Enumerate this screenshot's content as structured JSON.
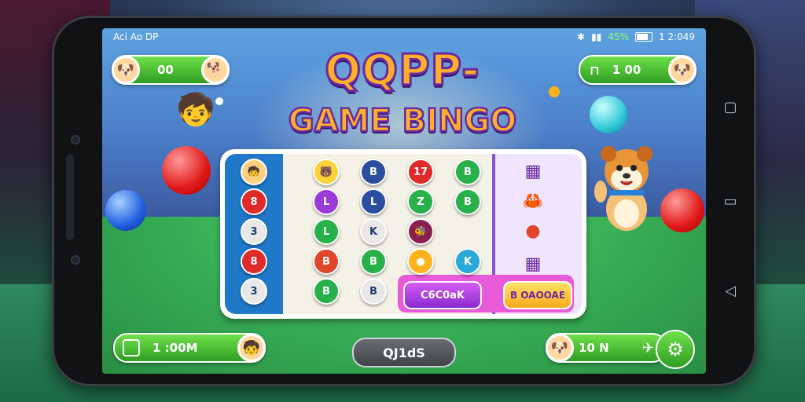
{
  "status_bar": {
    "left_text": "Aci Ao DP",
    "battery": "45%",
    "time": "1 2:049"
  },
  "title": {
    "line1": "QQPP-",
    "line2": "GAME BINGO"
  },
  "top_left_pill": {
    "value": "00",
    "icon": "dog-avatar-icon",
    "avatar": "dog-avatar-icon"
  },
  "top_right_pill": {
    "value": "1 00",
    "icon": "bottle-icon",
    "avatar": "dog-avatar-icon"
  },
  "board": {
    "left_column": [
      {
        "label": "",
        "color": "#ffd080",
        "icon": "kid-avatar-icon"
      },
      {
        "label": "8",
        "color": "#e02a2a"
      },
      {
        "label": "3",
        "color": "#e8e8e8"
      },
      {
        "label": "8",
        "color": "#e02a2a"
      },
      {
        "label": "3",
        "color": "#e8e8e8"
      }
    ],
    "grid": [
      {
        "label": "",
        "color": "#ffd23a",
        "icon": "bear-face-icon"
      },
      {
        "label": "B",
        "color": "#2a4fa0"
      },
      {
        "label": "17",
        "color": "#e02a2a"
      },
      {
        "label": "B",
        "color": "#28b04a"
      },
      {
        "label": "L",
        "color": "#9a3ad8"
      },
      {
        "label": "L",
        "color": "#2a4fa0"
      },
      {
        "label": "Z",
        "color": "#28b04a"
      },
      {
        "label": "B",
        "color": "#28b04a"
      },
      {
        "label": "L",
        "color": "#28b04a"
      },
      {
        "label": "K",
        "color": "#e8e8e8"
      },
      {
        "label": "",
        "color": "#8a1f50",
        "icon": "bee-icon"
      },
      {
        "label": "B",
        "color": "#e0442a"
      },
      {
        "label": "B",
        "color": "#28b04a"
      },
      {
        "label": "",
        "color": "#ffb21c",
        "icon": "tennis-ball-icon"
      },
      {
        "label": "K",
        "color": "#2aa8d8"
      },
      {
        "label": "B",
        "color": "#28b04a"
      },
      {
        "label": "B",
        "color": "#e8e8e8"
      }
    ],
    "right_column_icons": [
      "game-card-icon",
      "crab-icon",
      "red-ball-icon",
      "game-card-icon"
    ],
    "check_button": "C6C0aK",
    "bingo_button": "B OAOOAE"
  },
  "bottom_left_pill": {
    "value": "1 :00M",
    "icon": "card-icon",
    "avatar": "kid-avatar-icon"
  },
  "bottom_center_button": "QJ1dS",
  "bottom_right_pill": {
    "value": "10 N",
    "icon": "plane-icon",
    "avatar": "dog-avatar-icon"
  },
  "settings_icon": "gear-icon",
  "colors": {
    "accent_green": "#2f9d23",
    "title_orange": "#ffb02a",
    "title_outline": "#6a2aa0",
    "board_blue": "#1f78c8",
    "board_purple": "#8a52d8"
  }
}
